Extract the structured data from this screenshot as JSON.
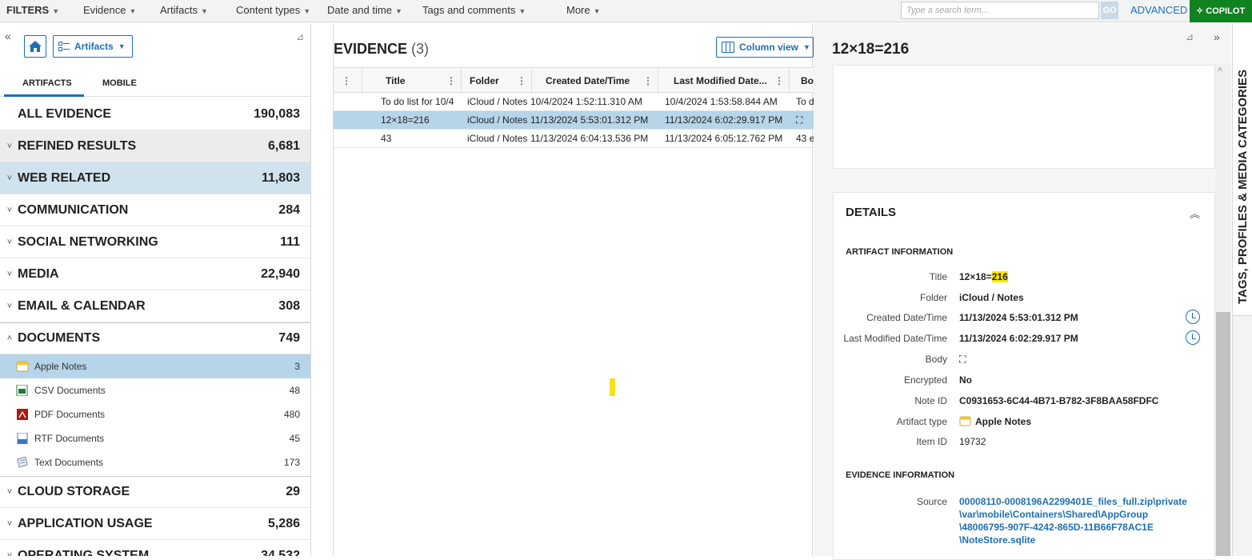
{
  "topbar": {
    "filters": "FILTERS",
    "menus": [
      "Evidence",
      "Artifacts",
      "Content types",
      "Date and time",
      "Tags and comments",
      "More"
    ],
    "search_placeholder": "Type a search term...",
    "go": "GO",
    "advanced": "ADVANCED",
    "copilot": "COPILOT"
  },
  "left": {
    "dropdown": "Artifacts",
    "tabs": [
      "ARTIFACTS",
      "MOBILE"
    ],
    "categories": [
      {
        "name": "ALL EVIDENCE",
        "count": "190,083",
        "chev": ""
      },
      {
        "name": "REFINED RESULTS",
        "count": "6,681",
        "chev": "˅"
      },
      {
        "name": "WEB RELATED",
        "count": "11,803",
        "chev": "˅"
      },
      {
        "name": "COMMUNICATION",
        "count": "284",
        "chev": "˅"
      },
      {
        "name": "SOCIAL NETWORKING",
        "count": "111",
        "chev": "˅"
      },
      {
        "name": "MEDIA",
        "count": "22,940",
        "chev": "˅"
      },
      {
        "name": "EMAIL & CALENDAR",
        "count": "308",
        "chev": "˅"
      },
      {
        "name": "DOCUMENTS",
        "count": "749",
        "chev": "˄"
      }
    ],
    "documents": [
      {
        "name": "Apple Notes",
        "count": "3"
      },
      {
        "name": "CSV Documents",
        "count": "48"
      },
      {
        "name": "PDF Documents",
        "count": "480"
      },
      {
        "name": "RTF Documents",
        "count": "45"
      },
      {
        "name": "Text Documents",
        "count": "173"
      }
    ],
    "categories2": [
      {
        "name": "CLOUD STORAGE",
        "count": "29",
        "chev": "˅"
      },
      {
        "name": "APPLICATION USAGE",
        "count": "5,286",
        "chev": "˅"
      },
      {
        "name": "OPERATING SYSTEM",
        "count": "34,532",
        "chev": "˅"
      }
    ]
  },
  "evidence": {
    "title": "EVIDENCE",
    "count": "(3)",
    "column_view": "Column view",
    "columns": [
      "Title",
      "Folder",
      "Created Date/Time",
      "Last Modified Date...",
      "Bo"
    ],
    "rows": [
      [
        "To do list for 10/4",
        "iCloud / Notes",
        "10/4/2024 1:52:11.310 AM",
        "10/4/2024 1:53:58.844 AM",
        "To d"
      ],
      [
        "12×18=216",
        "iCloud / Notes",
        "11/13/2024 5:53:01.312 PM",
        "11/13/2024 6:02:29.917 PM",
        "⛶"
      ],
      [
        "43",
        "iCloud / Notes",
        "11/13/2024 6:04:13.536 PM",
        "11/13/2024 6:05:12.762 PM",
        "43 e"
      ]
    ]
  },
  "right": {
    "title": "12×18=216",
    "details": "DETAILS",
    "artifact_info": "ARTIFACT INFORMATION",
    "fields": {
      "title_k": "Title",
      "title_pre": "12×18=",
      "title_hl": "216",
      "folder_k": "Folder",
      "folder_v": "iCloud / Notes",
      "created_k": "Created Date/Time",
      "created_v": "11/13/2024 5:53:01.312 PM",
      "modified_k": "Last Modified Date/Time",
      "modified_v": "11/13/2024 6:02:29.917 PM",
      "body_k": "Body",
      "body_v": "⛶",
      "enc_k": "Encrypted",
      "enc_v": "No",
      "noteid_k": "Note ID",
      "noteid_v": "C0931653-6C44-4B71-B782-3F8BAA58FDFC",
      "type_k": "Artifact type",
      "type_v": "Apple Notes",
      "item_k": "Item ID",
      "item_v": "19732"
    },
    "evidence_info": "EVIDENCE INFORMATION",
    "source_k": "Source",
    "source_lines": [
      "00008110-0008196A2299401E_files_full.zip\\private",
      "\\var\\mobile\\Containers\\Shared\\AppGroup",
      "\\48006795-907F-4242-865D-11B66F78AC1E",
      "\\NoteStore.sqlite"
    ]
  },
  "sidetab": "TAGS, PROFILES & MEDIA CATEGORIES"
}
